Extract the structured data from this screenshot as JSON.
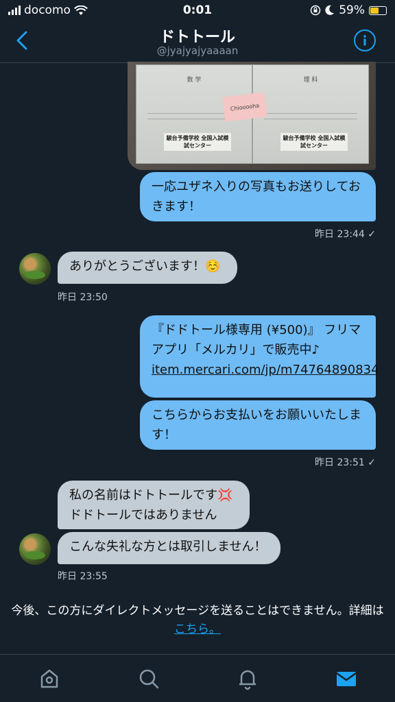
{
  "status": {
    "carrier": "docomo",
    "time": "0:01",
    "battery": "59%",
    "battery_level": 0.59
  },
  "header": {
    "title": "ドトトール",
    "handle": "@jyajyajyaaaan"
  },
  "photo": {
    "book_left_title": "数 学",
    "book_right_title": "理 科",
    "org_left": "駿台予備学校 全国入試模試センター",
    "org_right": "駿台予備学校 全国入試模試センター",
    "sticky_text": "Chiooooha"
  },
  "messages": {
    "m1": "一応ユザネ入りの写真もお送りしておきます！",
    "m1_time": "昨日 23:44 ✓",
    "m2": "ありがとうございます！☺️",
    "m2_time": "昨日 23:50",
    "m3_text": "『ドドトール様専用 (¥500)』 フリマアプリ「メルカリ」で販売中♪",
    "m3_link": "item.mercari.com/jp/m74764890834",
    "m4": "こちらからお支払いをお願いいたします！",
    "m4_time": "昨日 23:51 ✓",
    "m5": "私の名前はドトトールです💢 ドドトールではありません",
    "m6": "こんな失礼な方とは取引しません！",
    "m6_time": "昨日 23:55"
  },
  "notice": {
    "text": "今後、この方にダイレクトメッセージを送ることはできません。詳細は",
    "link": "こちら。"
  },
  "tabs": [
    "home-icon",
    "search-icon",
    "bell-icon",
    "mail-icon"
  ],
  "colors": {
    "background": "#15202b",
    "outgoing_bubble": "#6fbbf5",
    "incoming_bubble": "#c3cdd5",
    "accent": "#1da1f2"
  }
}
